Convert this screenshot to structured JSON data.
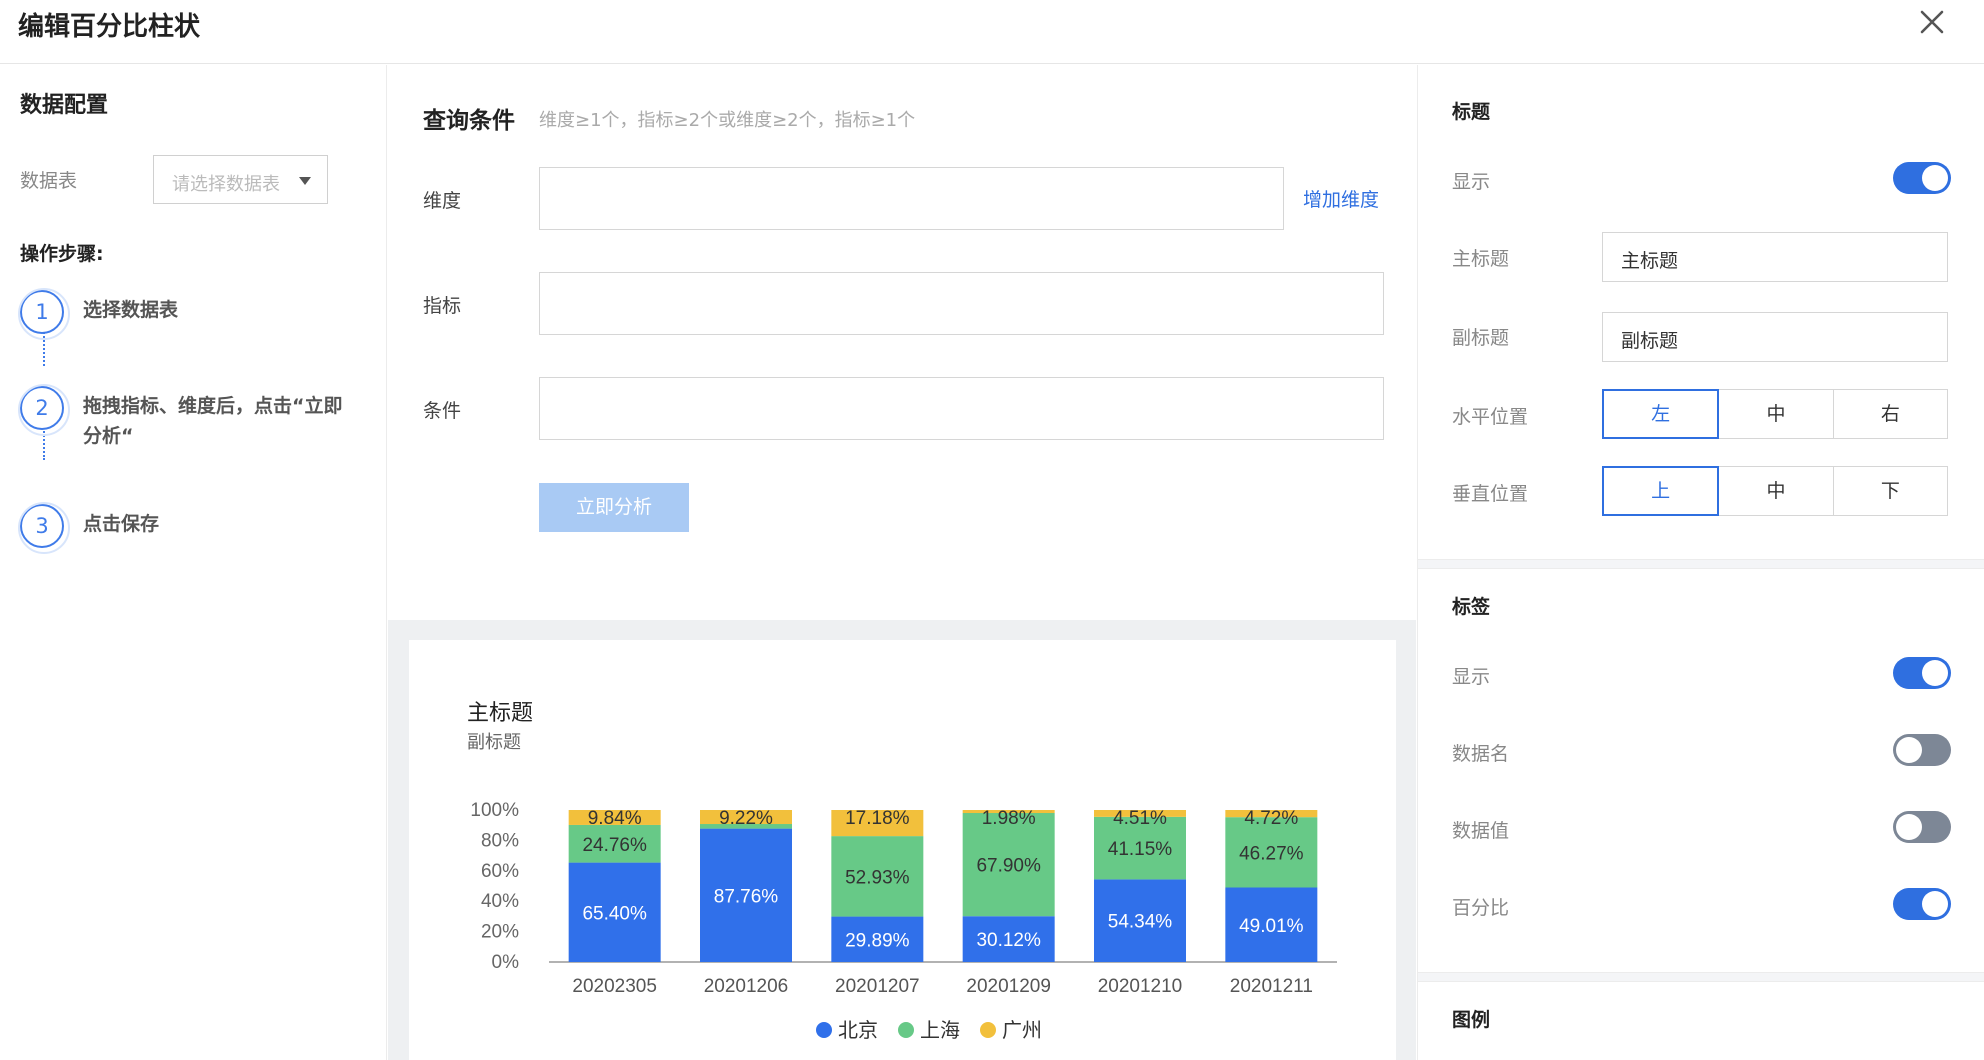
{
  "dialog": {
    "title": "编辑百分比柱状",
    "close_icon": "close-icon"
  },
  "data_config": {
    "title": "数据配置",
    "table_label": "数据表",
    "table_placeholder": "请选择数据表",
    "steps_title": "操作步骤:",
    "steps": [
      {
        "num": "1",
        "text": "选择数据表"
      },
      {
        "num": "2",
        "text_line1": "拖拽指标、维度后，点击“立即",
        "text_line2": "分析“"
      },
      {
        "num": "3",
        "text": "点击保存"
      }
    ]
  },
  "query": {
    "title": "查询条件",
    "hint": "维度≥1个，指标≥2个或维度≥2个，指标≥1个",
    "dimension_label": "维度",
    "add_dimension": "增加维度",
    "metric_label": "指标",
    "condition_label": "条件",
    "analyze_button": "立即分析"
  },
  "chart_data": {
    "type": "bar",
    "stacked": "percent",
    "title": "主标题",
    "subtitle": "副标题",
    "categories": [
      "20202305",
      "20201206",
      "20201207",
      "20201209",
      "20201210",
      "20201211"
    ],
    "y_ticks": [
      "100%",
      "80%",
      "60%",
      "40%",
      "20%",
      "0%"
    ],
    "ylim": [
      0,
      100
    ],
    "series": [
      {
        "name": "北京",
        "color": "#3070ea",
        "values": [
          65.4,
          87.76,
          29.89,
          30.12,
          54.34,
          49.01
        ],
        "labels": [
          "65.40%",
          "87.76%",
          "29.89%",
          "30.12%",
          "54.34%",
          "49.01%"
        ]
      },
      {
        "name": "上海",
        "color": "#67c987",
        "values": [
          24.76,
          3.02,
          52.93,
          67.9,
          41.15,
          46.27
        ],
        "labels": [
          "24.76%",
          "",
          "52.93%",
          "67.90%",
          "41.15%",
          "46.27%"
        ]
      },
      {
        "name": "广州",
        "color": "#f2c03c",
        "values": [
          9.84,
          9.22,
          17.18,
          1.98,
          4.51,
          4.72
        ],
        "labels": [
          "9.84%",
          "9.22%",
          "17.18%",
          "1.98%",
          "4.51%",
          "4.72%"
        ]
      }
    ],
    "legend_position": "bottom"
  },
  "settings": {
    "title_section": "标题",
    "show_label": "显示",
    "title_show_on": true,
    "main_title_label": "主标题",
    "main_title_value": "主标题",
    "sub_title_label": "副标题",
    "sub_title_value": "副标题",
    "h_pos_label": "水平位置",
    "h_options": [
      "左",
      "中",
      "右"
    ],
    "v_pos_label": "垂直位置",
    "v_options": [
      "上",
      "中",
      "下"
    ],
    "tag_section": "标签",
    "tag_show_label": "显示",
    "tag_show_on": true,
    "data_name_label": "数据名",
    "data_name_on": false,
    "data_value_label": "数据值",
    "data_value_on": false,
    "percent_label": "百分比",
    "percent_on": true,
    "legend_section": "图例"
  }
}
